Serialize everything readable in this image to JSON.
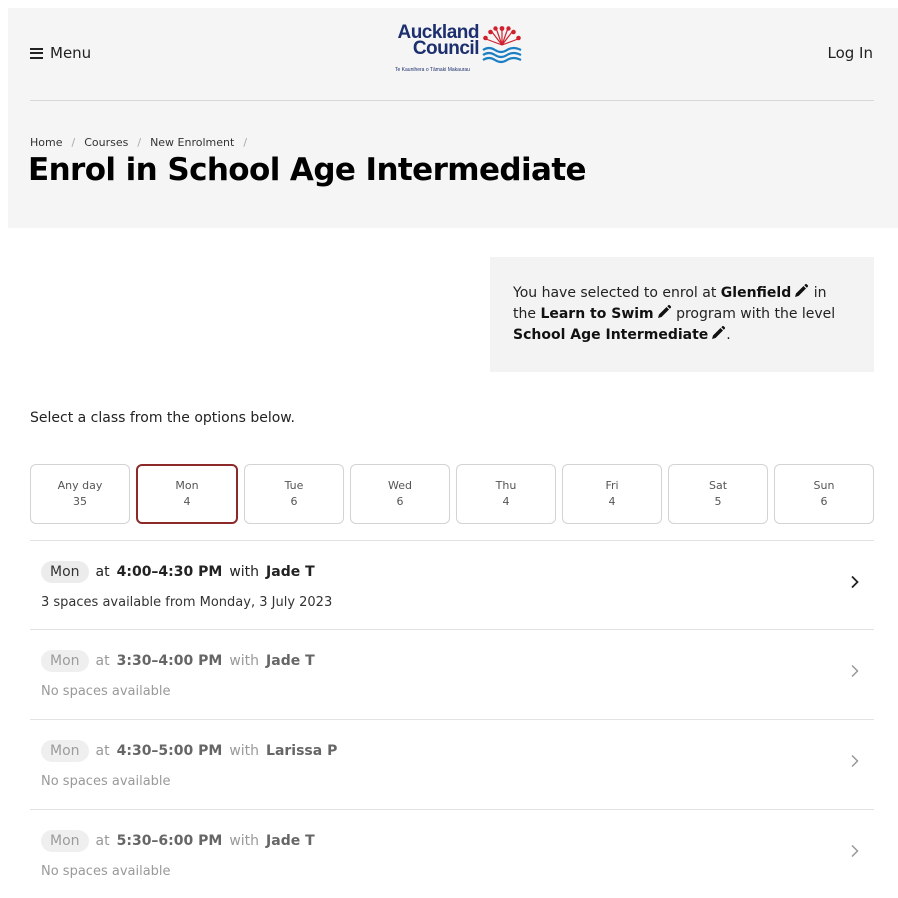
{
  "header": {
    "menu_label": "Menu",
    "logo": {
      "line1": "Auckland",
      "line2": "Council",
      "tagline": "Te Kaunihera o Tāmaki Makaurau"
    },
    "login_label": "Log In"
  },
  "breadcrumb": [
    "Home",
    "Courses",
    "New Enrolment"
  ],
  "page_title": "Enrol in School Age Intermediate",
  "selection": {
    "text1": "You have selected to enrol at ",
    "location": "Glenfield",
    "text2": " in the ",
    "program": "Learn to Swim",
    "text3": " program with the level ",
    "level": "School Age Intermediate",
    "text4": "."
  },
  "instruction": "Select a class from the options below.",
  "day_tabs": [
    {
      "label": "Any day",
      "count": "35"
    },
    {
      "label": "Mon",
      "count": "4"
    },
    {
      "label": "Tue",
      "count": "6"
    },
    {
      "label": "Wed",
      "count": "6"
    },
    {
      "label": "Thu",
      "count": "4"
    },
    {
      "label": "Fri",
      "count": "4"
    },
    {
      "label": "Sat",
      "count": "5"
    },
    {
      "label": "Sun",
      "count": "6"
    }
  ],
  "selected_day": "Mon",
  "classes": [
    {
      "day": "Mon",
      "at": "at",
      "time": "4:00–4:30 PM",
      "with": "with",
      "instructor": "Jade T",
      "availability": "3 spaces available from Monday, 3 July 2023",
      "available": true
    },
    {
      "day": "Mon",
      "at": "at",
      "time": "3:30–4:00 PM",
      "with": "with",
      "instructor": "Jade T",
      "availability": "No spaces available",
      "available": false
    },
    {
      "day": "Mon",
      "at": "at",
      "time": "4:30–5:00 PM",
      "with": "with",
      "instructor": "Larissa P",
      "availability": "No spaces available",
      "available": false
    },
    {
      "day": "Mon",
      "at": "at",
      "time": "5:30–6:00 PM",
      "with": "with",
      "instructor": "Jade T",
      "availability": "No spaces available",
      "available": false
    }
  ],
  "colors": {
    "selected_tab_border": "#8c2a2a",
    "hero_bg": "#f5f5f5",
    "logo_blue": "#1c2f6e",
    "logo_red": "#d0202e"
  },
  "icons": [
    "menu-icon",
    "pencil-icon",
    "chevron-right-icon"
  ]
}
